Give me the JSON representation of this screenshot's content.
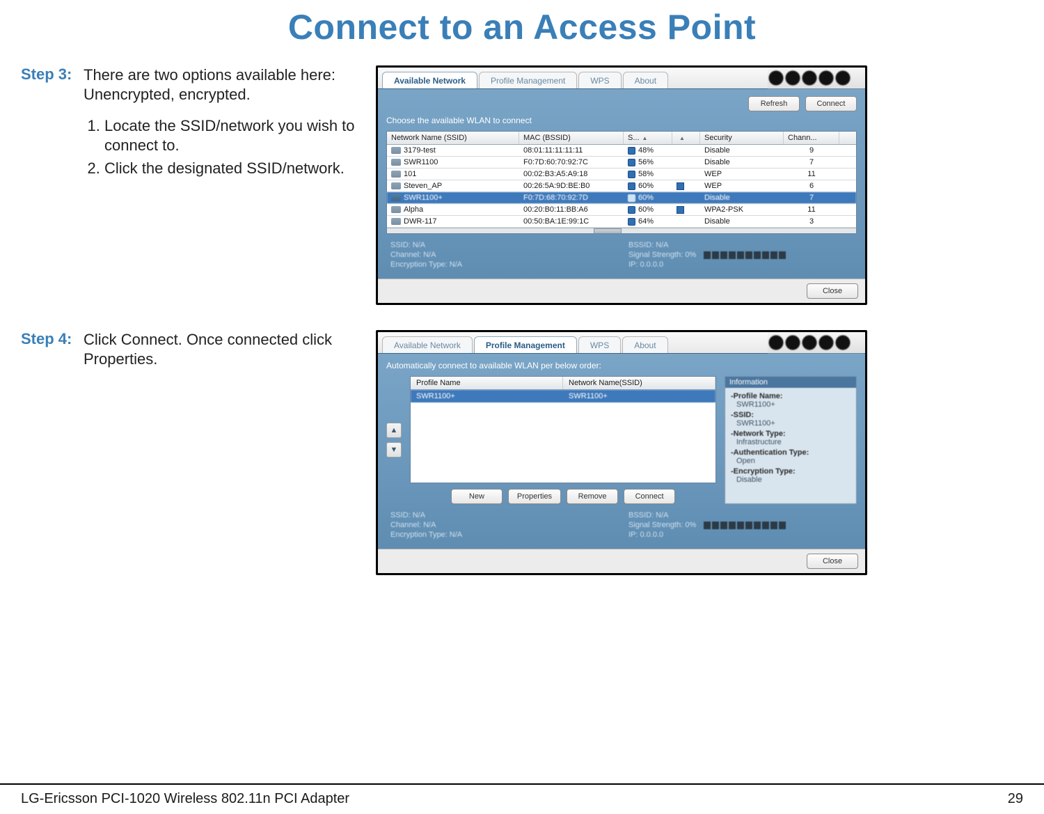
{
  "page": {
    "title": "Connect to an Access Point",
    "footer_product": "LG-Ericsson PCI-1020 Wireless 802.11n PCI Adapter",
    "footer_page": "29"
  },
  "step3": {
    "label": "Step 3:",
    "intro1": "There are two options available here:",
    "intro2": "Unencrypted, encrypted.",
    "li1": "Locate the SSID/network you wish to connect to.",
    "li2": "Click the designated SSID/network."
  },
  "step4": {
    "label": "Step 4:",
    "text": "Click Connect. Once connected click Properties."
  },
  "tabs": {
    "available": "Available Network",
    "profile": "Profile Management",
    "wps": "WPS",
    "about": "About"
  },
  "winA": {
    "title": "Choose the available WLAN to connect",
    "refresh": "Refresh",
    "connect": "Connect",
    "close": "Close",
    "cols": {
      "ssid": "Network Name (SSID)",
      "mac": "MAC (BSSID)",
      "sig": "S...",
      "blank": "",
      "sec": "Security",
      "chan": "Chann..."
    },
    "rows": [
      {
        "ssid": "3179-test",
        "mac": "08:01:11:11:11:11",
        "sig": "48%",
        "chk": "",
        "sec": "Disable",
        "chan": "9"
      },
      {
        "ssid": "SWR1100",
        "mac": "F0:7D:60:70:92:7C",
        "sig": "56%",
        "chk": "",
        "sec": "Disable",
        "chan": "7"
      },
      {
        "ssid": "101",
        "mac": "00:02:B3:A5:A9:18",
        "sig": "58%",
        "chk": "",
        "sec": "WEP",
        "chan": "11"
      },
      {
        "ssid": "Steven_AP",
        "mac": "00:26:5A:9D:BE:B0",
        "sig": "60%",
        "chk": "x",
        "sec": "WEP",
        "chan": "6"
      },
      {
        "ssid": "SWR1100+",
        "mac": "F0:7D:68:70:92:7D",
        "sig": "60%",
        "chk": "",
        "sec": "Disable",
        "chan": "7",
        "sel": true
      },
      {
        "ssid": "Alpha",
        "mac": "00:20:B0:11:BB:A6",
        "sig": "60%",
        "chk": "x",
        "sec": "WPA2-PSK",
        "chan": "11"
      },
      {
        "ssid": "DWR-117",
        "mac": "00:50:BA:1E:99:1C",
        "sig": "64%",
        "chk": "",
        "sec": "Disable",
        "chan": "3"
      }
    ],
    "status": {
      "ssid_lbl": "SSID: N/A",
      "bssid_lbl": "BSSID: N/A",
      "chan_lbl": "Channel: N/A",
      "sig_lbl": "Signal Strength: 0%",
      "enc_lbl": "Encryption Type: N/A",
      "ip_lbl": "IP: 0.0.0.0"
    }
  },
  "winB": {
    "title": "Automatically connect to available WLAN per below order:",
    "close": "Close",
    "cols": {
      "pname": "Profile Name",
      "nname": "Network Name(SSID)"
    },
    "row": {
      "pname": "SWR1100+",
      "nname": "SWR1100+"
    },
    "buttons": {
      "new": "New",
      "prop": "Properties",
      "rem": "Remove",
      "conn": "Connect"
    },
    "info": {
      "header": "Information",
      "pn_lbl": "-Profile Name:",
      "pn": "SWR1100+",
      "ss_lbl": "-SSID:",
      "ss": "SWR1100+",
      "nt_lbl": "-Network Type:",
      "nt": "Infrastructure",
      "at_lbl": "-Authentication Type:",
      "at": "Open",
      "et_lbl": "-Encryption Type:",
      "et": "Disable"
    },
    "status": {
      "ssid_lbl": "SSID: N/A",
      "bssid_lbl": "BSSID: N/A",
      "chan_lbl": "Channel: N/A",
      "sig_lbl": "Signal Strength: 0%",
      "enc_lbl": "Encryption Type: N/A",
      "ip_lbl": "IP: 0.0.0.0"
    }
  }
}
